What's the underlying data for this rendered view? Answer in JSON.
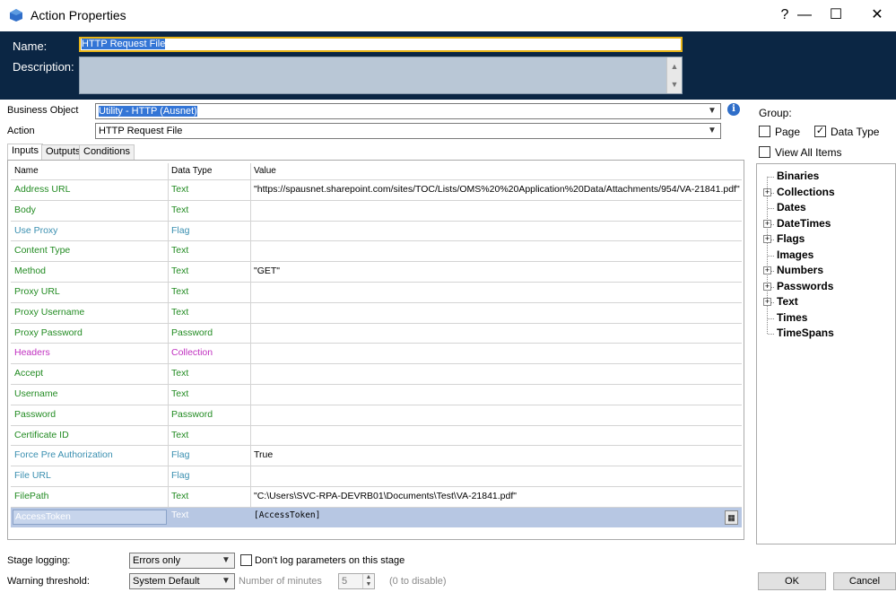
{
  "window": {
    "title": "Action Properties",
    "help": "?",
    "minimize": "—",
    "maximize": "☐",
    "close": "✕"
  },
  "header": {
    "name_label": "Name:",
    "name_value": "HTTP Request File",
    "description_label": "Description:",
    "description_value": ""
  },
  "form": {
    "business_object_label": "Business Object",
    "business_object_value": "Utility - HTTP (Ausnet)",
    "action_label": "Action",
    "action_value": "HTTP Request File"
  },
  "tabs": [
    "Inputs",
    "Outputs",
    "Conditions"
  ],
  "grid": {
    "columns": [
      "Name",
      "Data Type",
      "Value"
    ],
    "rows": [
      {
        "name": "Address URL",
        "type": "Text",
        "value": "\"https://spausnet.sharepoint.com/sites/TOC/Lists/OMS%20%20Application%20Data/Attachments/954/VA-21841.pdf\"",
        "color": "green"
      },
      {
        "name": "Body",
        "type": "Text",
        "value": "",
        "color": "green"
      },
      {
        "name": "Use Proxy",
        "type": "Flag",
        "value": "",
        "color": "blue"
      },
      {
        "name": "Content Type",
        "type": "Text",
        "value": "",
        "color": "green"
      },
      {
        "name": "Method",
        "type": "Text",
        "value": "\"GET\"",
        "color": "green"
      },
      {
        "name": "Proxy URL",
        "type": "Text",
        "value": "",
        "color": "green"
      },
      {
        "name": "Proxy Username",
        "type": "Text",
        "value": "",
        "color": "green"
      },
      {
        "name": "Proxy Password",
        "type": "Password",
        "value": "",
        "color": "green"
      },
      {
        "name": "Headers",
        "type": "Collection",
        "value": "",
        "color": "magenta"
      },
      {
        "name": "Accept",
        "type": "Text",
        "value": "",
        "color": "green"
      },
      {
        "name": "Username",
        "type": "Text",
        "value": "",
        "color": "green"
      },
      {
        "name": "Password",
        "type": "Password",
        "value": "",
        "color": "green"
      },
      {
        "name": "Certificate ID",
        "type": "Text",
        "value": "",
        "color": "green"
      },
      {
        "name": "Force Pre Authorization",
        "type": "Flag",
        "value": "True",
        "color": "blue"
      },
      {
        "name": "File URL",
        "type": "Flag",
        "value": "",
        "color": "blue"
      },
      {
        "name": "FilePath",
        "type": "Text",
        "value": "\"C:\\Users\\SVC-RPA-DEVRB01\\Documents\\Test\\VA-21841.pdf\"",
        "color": "green"
      },
      {
        "name": "AccessToken",
        "type": "Text",
        "value": "[AccessToken]",
        "color": "selected"
      }
    ]
  },
  "group": {
    "label": "Group:",
    "page_label": "Page",
    "page_checked": false,
    "datatype_label": "Data Type",
    "datatype_checked": true,
    "view_all_label": "View All Items",
    "view_all_checked": false
  },
  "tree": [
    {
      "label": "Binaries",
      "expandable": false
    },
    {
      "label": "Collections",
      "expandable": true
    },
    {
      "label": "Dates",
      "expandable": false
    },
    {
      "label": "DateTimes",
      "expandable": true
    },
    {
      "label": "Flags",
      "expandable": true
    },
    {
      "label": "Images",
      "expandable": false
    },
    {
      "label": "Numbers",
      "expandable": true
    },
    {
      "label": "Passwords",
      "expandable": true
    },
    {
      "label": "Text",
      "expandable": true
    },
    {
      "label": "Times",
      "expandable": false
    },
    {
      "label": "TimeSpans",
      "expandable": false
    }
  ],
  "bottom": {
    "stage_logging_label": "Stage logging:",
    "stage_logging_value": "Errors only",
    "dont_log_label": "Don't log parameters on this stage",
    "warning_label": "Warning threshold:",
    "warning_value": "System Default",
    "minutes_label": "Number of minutes",
    "minutes_value": "5",
    "disable_hint": "(0 to disable)",
    "ok_label": "OK",
    "cancel_label": "Cancel"
  },
  "colors": {
    "header_bg": "#0b2644",
    "name_border": "#e8b417",
    "selection": "#3375d6",
    "selected_row": "#b7c7e3"
  }
}
